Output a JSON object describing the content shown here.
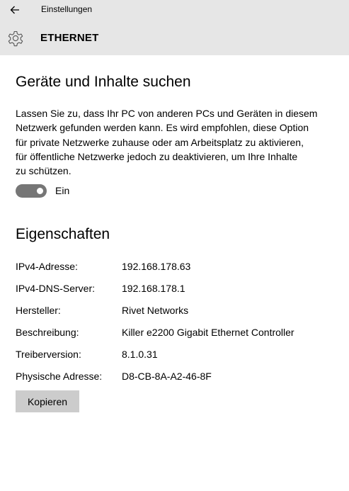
{
  "window": {
    "title": "Einstellungen"
  },
  "header": {
    "title": "ETHERNET",
    "icon": "gear-icon"
  },
  "discovery": {
    "heading": "Geräte und Inhalte suchen",
    "description_lines": [
      "Lassen Sie zu, dass Ihr PC von anderen PCs und Geräten in diesem",
      "Netzwerk gefunden werden kann. Es wird empfohlen, diese Option",
      "für private Netzwerke zuhause oder am Arbeitsplatz zu aktivieren,",
      "für öffentliche Netzwerke jedoch zu deaktivieren, um Ihre Inhalte",
      "zu schützen."
    ],
    "toggle_state": "on",
    "toggle_label": "Ein"
  },
  "properties": {
    "heading": "Eigenschaften",
    "rows": [
      {
        "label": "IPv4-Adresse:",
        "value": "192.168.178.63"
      },
      {
        "label": "IPv4-DNS-Server:",
        "value": "192.168.178.1"
      },
      {
        "label": "Hersteller:",
        "value": "Rivet Networks"
      },
      {
        "label": "Beschreibung:",
        "value": "Killer e2200 Gigabit Ethernet Controller"
      },
      {
        "label": "Treiberversion:",
        "value": "8.1.0.31"
      },
      {
        "label": "Physische Adresse:",
        "value": "D8-CB-8A-A2-46-8F"
      }
    ],
    "copy_label": "Kopieren"
  },
  "colors": {
    "header_bg": "#e6e6e6",
    "toggle_on": "#767676",
    "button_bg": "#cccccc"
  }
}
